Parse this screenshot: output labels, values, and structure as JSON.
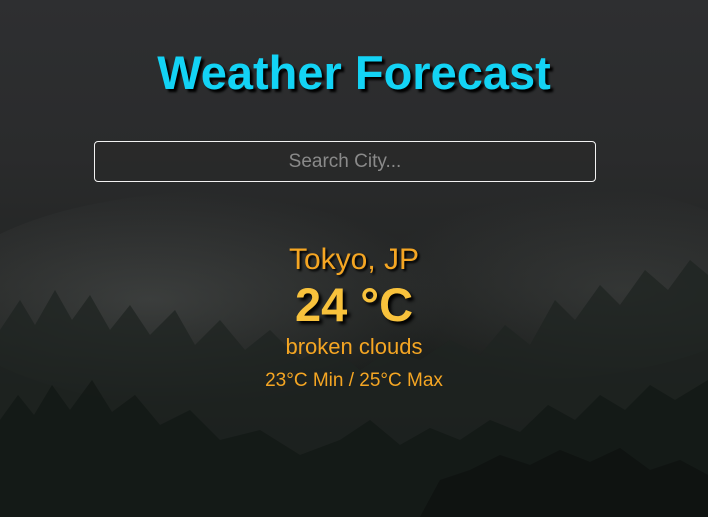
{
  "app": {
    "title": "Weather Forecast"
  },
  "search": {
    "placeholder": "Search City...",
    "value": ""
  },
  "weather": {
    "location": "Tokyo, JP",
    "temperature": "24 °C",
    "description": "broken clouds",
    "range": "23°C Min / 25°C Max"
  },
  "colors": {
    "title": "#13d3f5",
    "accent": "#f5a623",
    "temperature": "#f8c23c"
  }
}
